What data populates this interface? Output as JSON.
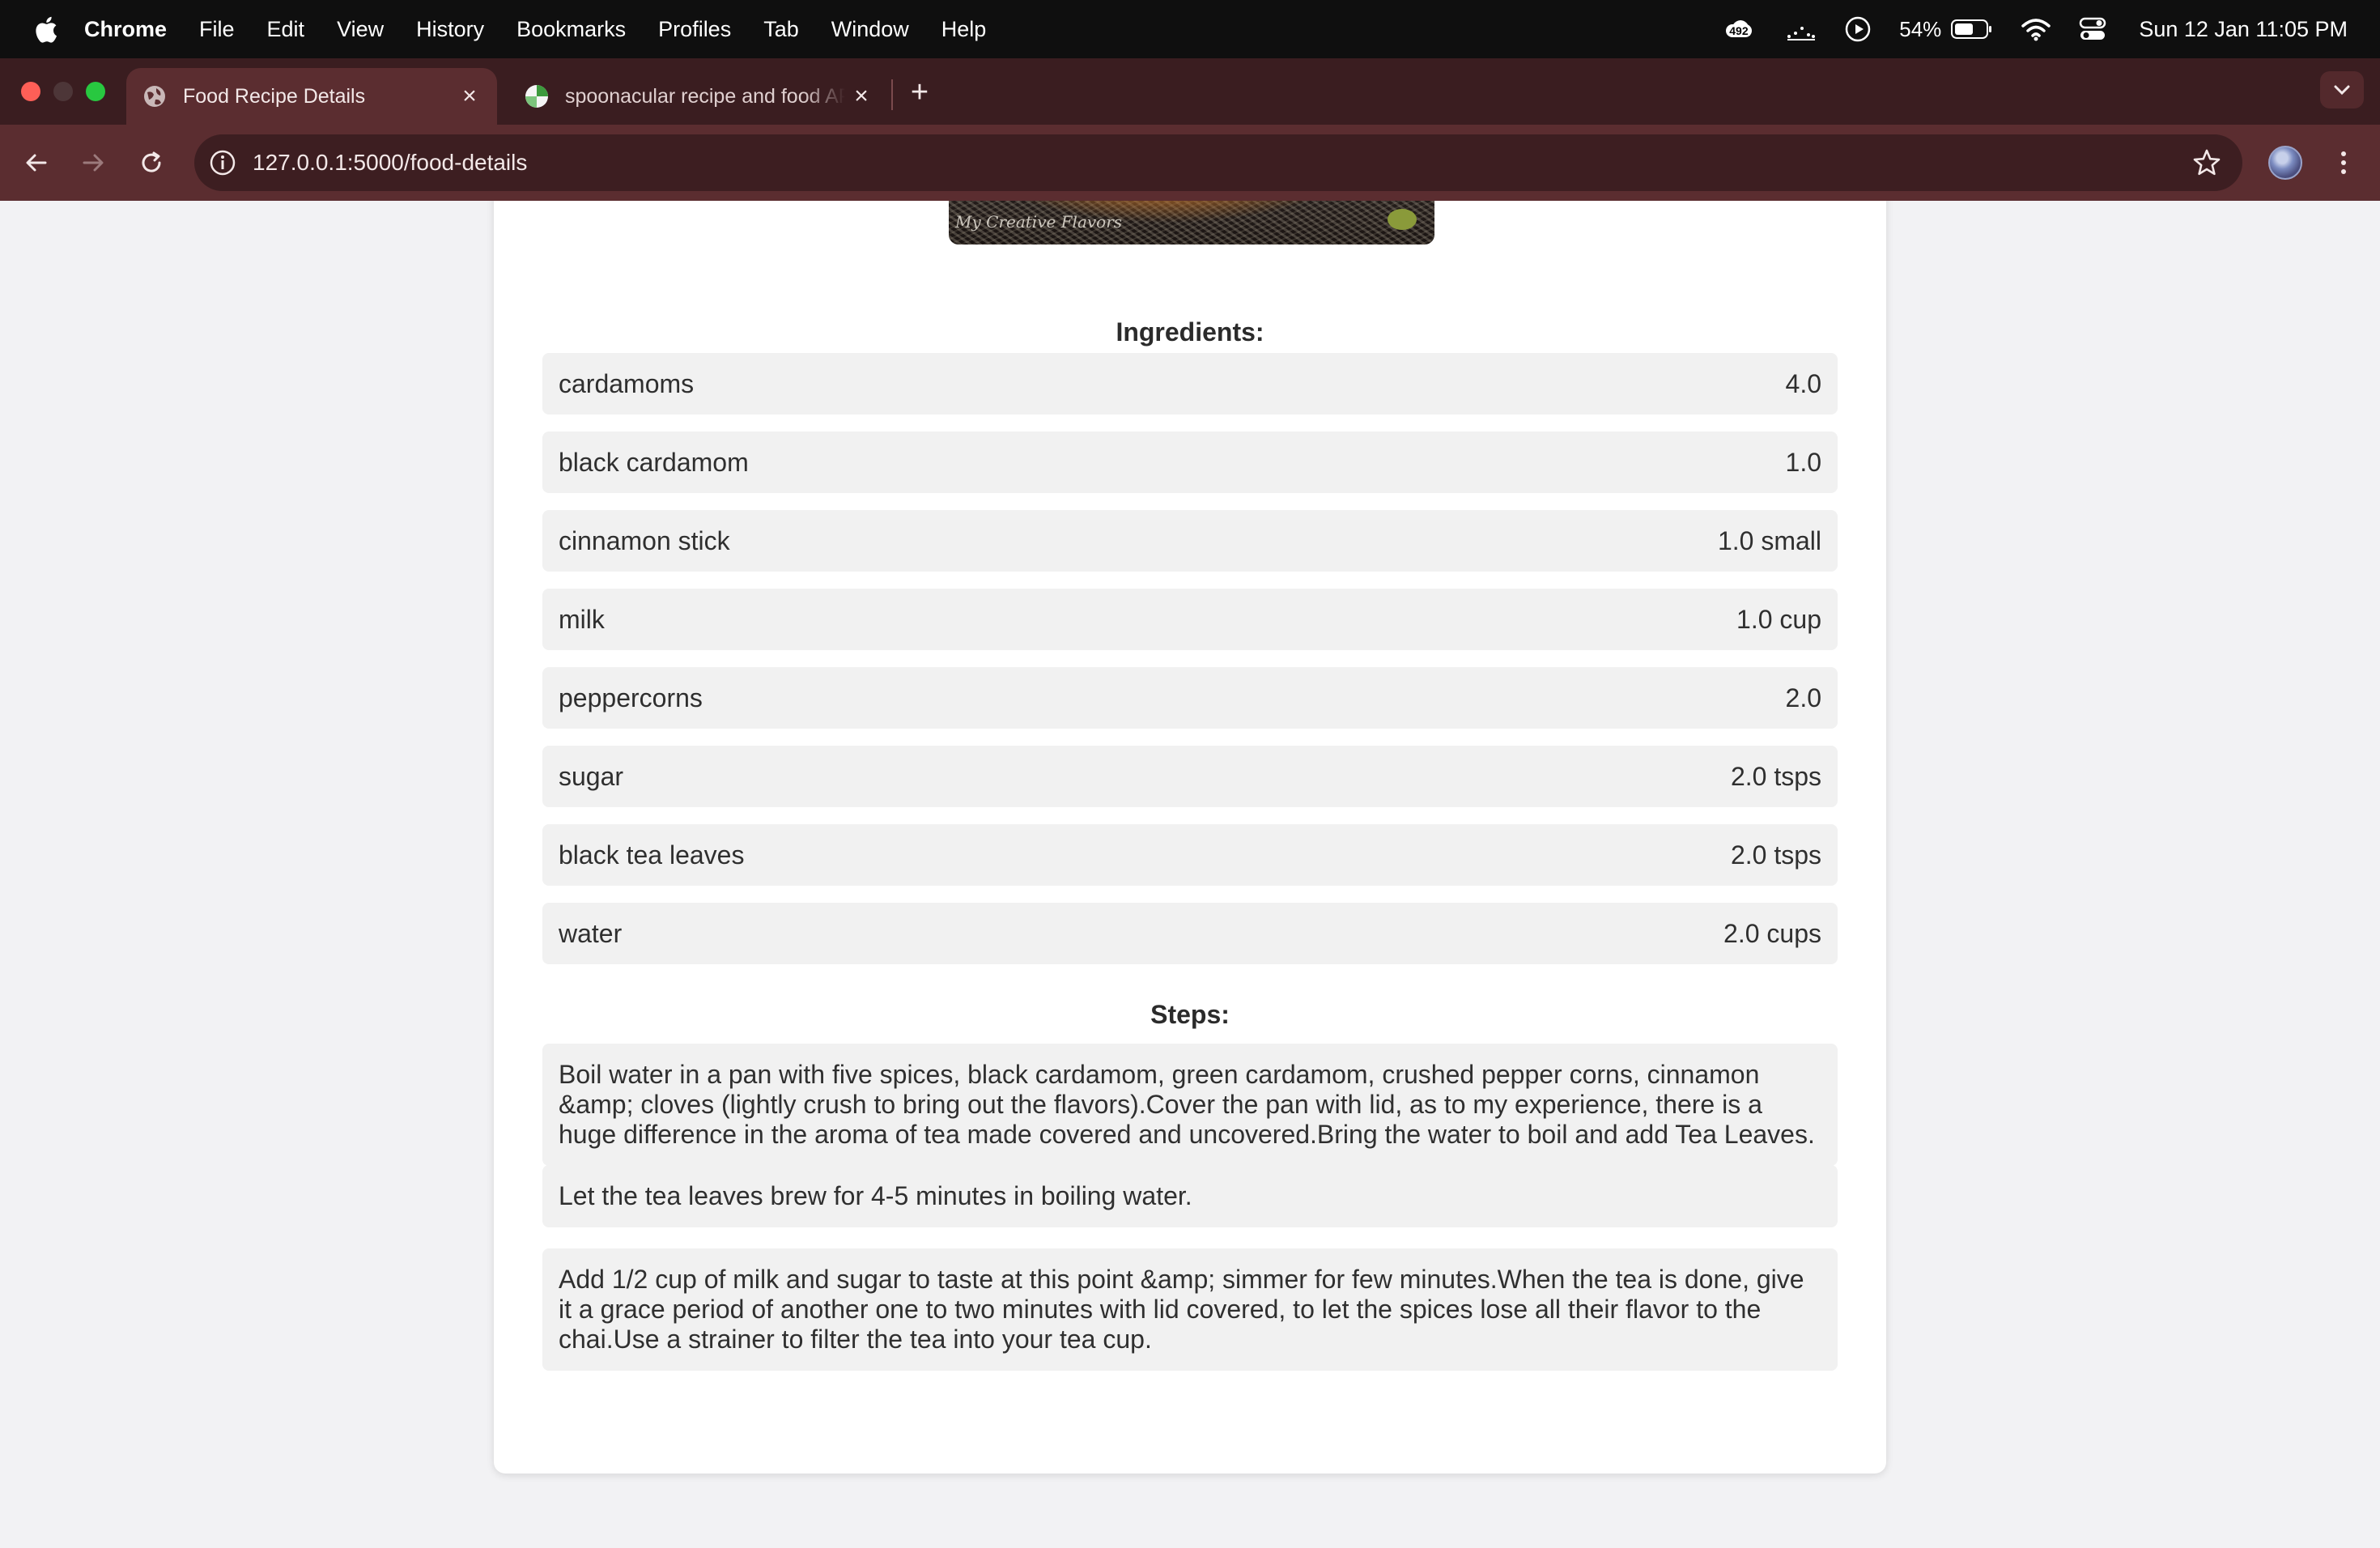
{
  "menubar": {
    "app_name": "Chrome",
    "items": [
      "File",
      "Edit",
      "View",
      "History",
      "Bookmarks",
      "Profiles",
      "Tab",
      "Window",
      "Help"
    ],
    "notification_count": "492",
    "battery": "54%",
    "datetime": "Sun 12 Jan  11:05 PM"
  },
  "tabs": [
    {
      "title": "Food Recipe Details",
      "active": true,
      "icon": "globe-icon"
    },
    {
      "title": "spoonacular recipe and food API",
      "active": false,
      "icon": "spoonacular-icon"
    }
  ],
  "toolbar": {
    "url": "127.0.0.1:5000/food-details"
  },
  "recipe": {
    "image_watermark": "My Creative Flavors",
    "ingredients_heading": "Ingredients:",
    "ingredients": [
      {
        "name": "cardamoms",
        "amount": "4.0"
      },
      {
        "name": "black cardamom",
        "amount": "1.0"
      },
      {
        "name": "cinnamon stick",
        "amount": "1.0 small"
      },
      {
        "name": "milk",
        "amount": "1.0 cup"
      },
      {
        "name": "peppercorns",
        "amount": "2.0"
      },
      {
        "name": "sugar",
        "amount": "2.0 tsps"
      },
      {
        "name": "black tea leaves",
        "amount": "2.0 tsps"
      },
      {
        "name": "water",
        "amount": "2.0 cups"
      }
    ],
    "steps_heading": "Steps:",
    "steps": [
      "Boil water in a pan with five spices, black cardamom, green cardamom, crushed pepper corns, cinnamon &amp; cloves (lightly crush to bring out the flavors).Cover the pan with lid, as to my experience, there is a huge difference in the aroma of tea made covered and uncovered.Bring the water to boil and add Tea Leaves.",
      "Let the tea leaves brew for 4-5 minutes in boiling water.",
      "Add 1/2 cup of milk and sugar to taste at this point &amp; simmer for few minutes.When the tea is done, give it a grace period of another one to two minutes with lid covered, to let the spices lose all their flavor to the chai.Use a strainer to filter the tea into your tea cup."
    ]
  },
  "colors": {
    "menubar_bg": "#0f0f0f",
    "tabstrip_bg": "#3a1d20",
    "toolbar_bg": "#5b2d30",
    "page_bg": "#f2f2f4",
    "row_bg": "#f1f1f1"
  }
}
